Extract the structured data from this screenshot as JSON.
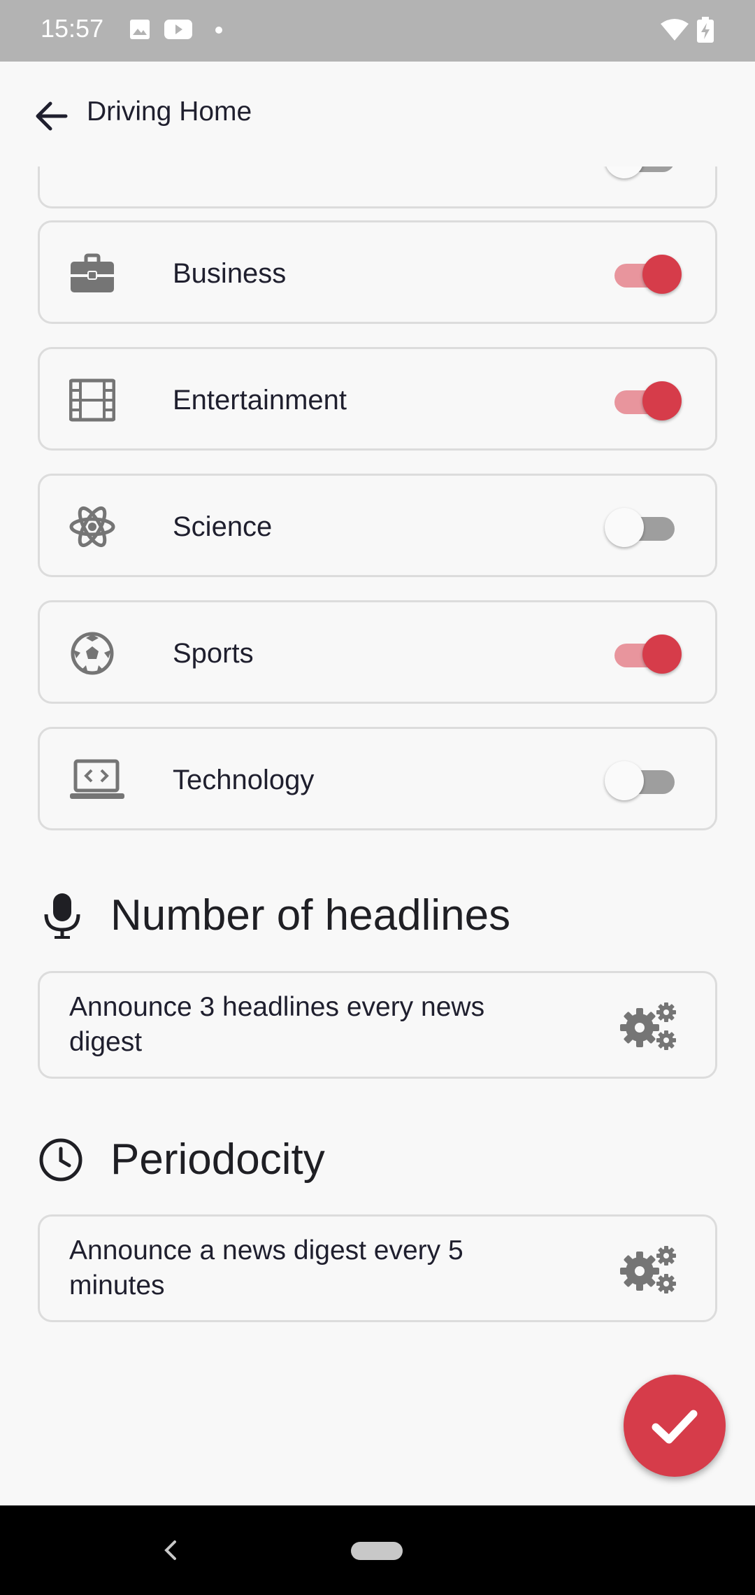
{
  "status_bar": {
    "time": "15:57"
  },
  "app_bar": {
    "title": "Driving Home"
  },
  "categories": [
    {
      "label": "Business",
      "icon": "briefcase-icon",
      "enabled": true
    },
    {
      "label": "Entertainment",
      "icon": "film-icon",
      "enabled": true
    },
    {
      "label": "Science",
      "icon": "atom-icon",
      "enabled": false
    },
    {
      "label": "Sports",
      "icon": "soccer-ball-icon",
      "enabled": true
    },
    {
      "label": "Technology",
      "icon": "laptop-code-icon",
      "enabled": false
    }
  ],
  "headlines": {
    "title": "Number of headlines",
    "description": "Announce 3 headlines every news digest"
  },
  "periodicity": {
    "title": "Periodocity",
    "description": "Announce a news digest every 5 minutes"
  },
  "colors": {
    "accent": "#d63c4a",
    "toggle_track_on": "#e8959d",
    "toggle_track_off": "#9e9e9e",
    "icon_gray": "#757575"
  }
}
